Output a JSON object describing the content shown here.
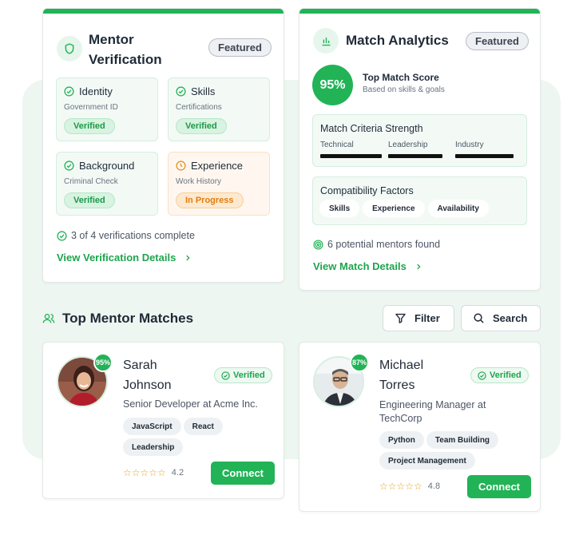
{
  "verification": {
    "title_line1": "Mentor",
    "title_line2": "Verification",
    "badge": "Featured",
    "items": [
      {
        "title": "Identity",
        "subtitle": "Government ID",
        "status": "Verified"
      },
      {
        "title": "Skills",
        "subtitle": "Certifications",
        "status": "Verified"
      },
      {
        "title": "Background",
        "subtitle": "Criminal Check",
        "status": "Verified"
      },
      {
        "title": "Experience",
        "subtitle": "Work History",
        "status": "In Progress"
      }
    ],
    "summary": "3 of 4 verifications complete",
    "link": "View Verification Details"
  },
  "analytics": {
    "title": "Match Analytics",
    "badge": "Featured",
    "score": "95%",
    "score_title": "Top Match Score",
    "score_subtitle": "Based on skills & goals",
    "criteria_title": "Match Criteria Strength",
    "criteria": [
      {
        "label": "Technical",
        "strength": 1.0
      },
      {
        "label": "Leadership",
        "strength": 0.87
      },
      {
        "label": "Industry",
        "strength": 0.95
      }
    ],
    "factors_title": "Compatibility Factors",
    "factors": [
      "Skills",
      "Experience",
      "Availability"
    ],
    "mentors_found": "6 potential mentors found",
    "link": "View Match Details"
  },
  "matches": {
    "title": "Top Mentor Matches",
    "filter_label": "Filter",
    "search_label": "Search",
    "mentors": [
      {
        "first": "Sarah",
        "last": "Johnson",
        "match": "95%",
        "verified": "Verified",
        "role": "Senior Developer at Acme Inc.",
        "tags": [
          "JavaScript",
          "React",
          "Leadership"
        ],
        "stars": "☆☆☆☆☆",
        "rating": "4.2",
        "connect": "Connect"
      },
      {
        "first": "Michael",
        "last": "Torres",
        "match": "87%",
        "verified": "Verified",
        "role_line1": "Engineering Manager at",
        "role_line2": "TechCorp",
        "tags": [
          "Python",
          "Team Building",
          "Project Management"
        ],
        "stars": "☆☆☆☆☆",
        "rating": "4.8",
        "connect": "Connect"
      }
    ]
  },
  "colors": {
    "accent": "#22b357",
    "warning": "#e07d10"
  }
}
